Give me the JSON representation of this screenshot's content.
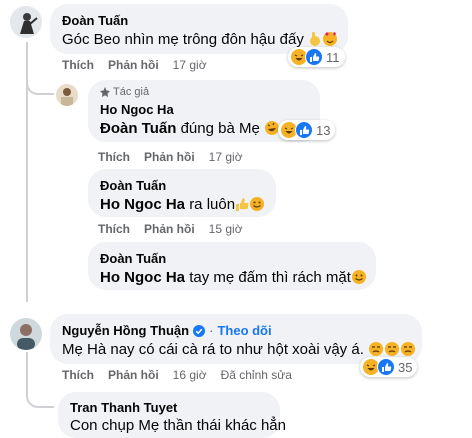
{
  "comments": [
    {
      "author": "Đoàn Tuấn",
      "text": "Góc Beo nhìn mẹ trông đôn hậu đấy",
      "actions": {
        "like": "Thích",
        "reply": "Phản hồi",
        "time": "17 giờ"
      },
      "reaction_count": "11"
    },
    {
      "badge": "Tác giả",
      "author": "Ho Ngoc Ha",
      "mention": "Đoàn Tuấn",
      "text": "đúng bà Mẹ",
      "actions": {
        "like": "Thích",
        "reply": "Phản hồi",
        "time": "17 giờ"
      },
      "reaction_count": "13"
    },
    {
      "author": "Đoàn Tuấn",
      "mention": "Ho Ngoc Ha",
      "text": "ra luôn",
      "actions": {
        "like": "Thích",
        "reply": "Phản hồi",
        "time": "15 giờ"
      }
    },
    {
      "author": "Đoàn Tuấn",
      "mention": "Ho Ngoc Ha",
      "text": "tay mẹ đấm thì rách mặt",
      "actions": {
        "like": "Thích",
        "reply": "Phản hồi",
        "time": "15 giờ"
      }
    },
    {
      "author": "Nguyễn Hồng Thuận",
      "separator": "·",
      "follow": "Theo dõi",
      "text": "Mẹ Hà nay có cái cà rá to như hột xoài vậy á.",
      "actions": {
        "like": "Thích",
        "reply": "Phản hồi",
        "time": "16 giờ",
        "edited": "Đã chỉnh sửa"
      },
      "reaction_count": "35"
    },
    {
      "author": "Tran Thanh Tuyet",
      "text": "Con chụp Mẹ thần thái khác hẳn"
    }
  ],
  "colors": {
    "bubble": "#f0f2f5",
    "link": "#1877f2",
    "muted": "#65676b",
    "haha": "#f7b125",
    "like": "#1877f2"
  },
  "icons": [
    "haha-emoji",
    "like-icon",
    "verified-badge-icon",
    "author-badge-icon",
    "pinch-hand-emoji",
    "love-face-emoji",
    "thumbs-up-emoji",
    "smile-emoji",
    "sad-emoji"
  ]
}
